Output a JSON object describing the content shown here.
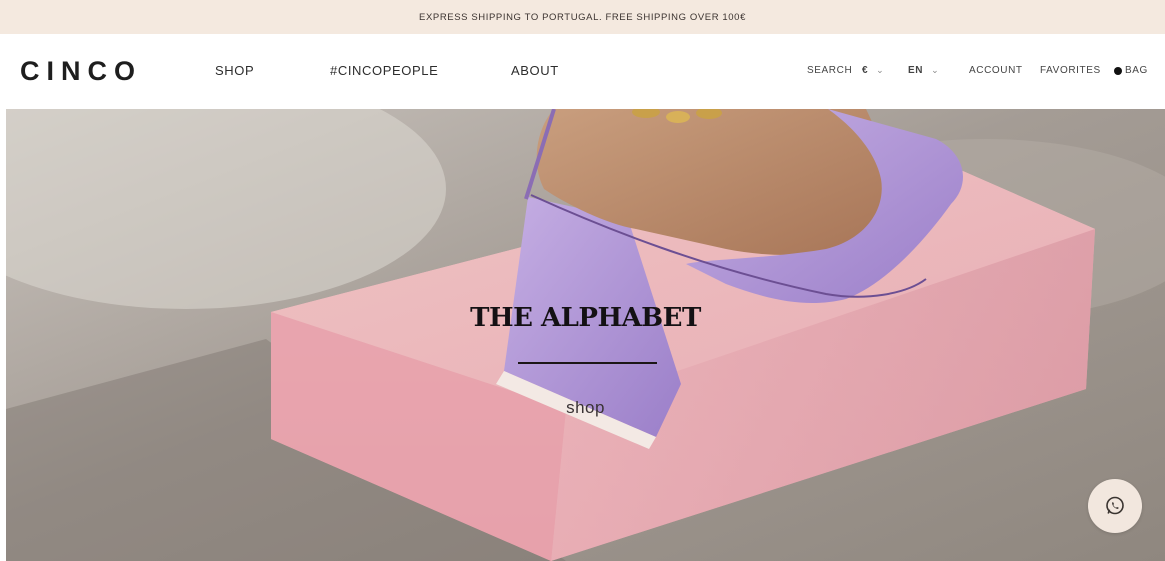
{
  "promo_bar": {
    "text": "EXPRESS SHIPPING TO PORTUGAL. FREE SHIPPING OVER 100€"
  },
  "header": {
    "logo": "CINCO",
    "nav": [
      {
        "label": "SHOP"
      },
      {
        "label": "#CINCOPEOPLE"
      },
      {
        "label": "ABOUT"
      }
    ],
    "utility": {
      "search": "SEARCH",
      "currency": "€",
      "language": "EN",
      "account": "ACCOUNT",
      "favorites": "FAVORITES",
      "bag": "BAG"
    }
  },
  "hero": {
    "title": "THE ALPHABET",
    "cta": "shop"
  },
  "floating": {
    "whatsapp_icon": "whatsapp-icon"
  },
  "colors": {
    "promo_bg": "#f4e9df",
    "whatsapp_bg": "#f2e7de",
    "text_dark": "#1e1e1e",
    "shoe_lilac": "#b79ad8",
    "block_pink": "#ebb4ba"
  }
}
